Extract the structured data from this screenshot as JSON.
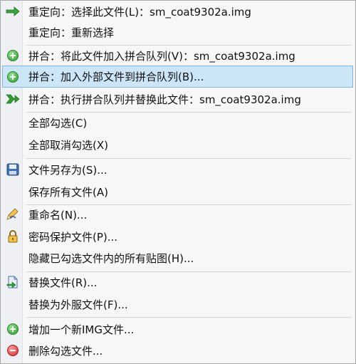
{
  "menu": {
    "items": [
      {
        "name": "redirect-select-this-file",
        "label": "重定向：选择此文件(L)：sm_coat9302a.img",
        "icon": "green-arrow-right-icon"
      },
      {
        "name": "redirect-reselect",
        "label": "重定向：重新选择",
        "icon": ""
      },
      {
        "name": "merge-add-this-file",
        "label": "拼合：将此文件加入拼合队列(V)：sm_coat9302a.img",
        "icon": "green-plus-circle-icon"
      },
      {
        "name": "merge-add-external-files",
        "label": "拼合：加入外部文件到拼合队列(B)...",
        "icon": "green-plus-circle-icon"
      },
      {
        "name": "merge-execute-replace",
        "label": "拼合：执行拼合队列并替换此文件：sm_coat9302a.img",
        "icon": "green-merge-arrow-icon"
      },
      {
        "name": "select-all",
        "label": "全部勾选(C)",
        "icon": ""
      },
      {
        "name": "deselect-all",
        "label": "全部取消勾选(X)",
        "icon": ""
      },
      {
        "name": "save-file-as",
        "label": "文件另存为(S)...",
        "icon": "floppy-disk-icon"
      },
      {
        "name": "save-all-files",
        "label": "保存所有文件(A)",
        "icon": ""
      },
      {
        "name": "rename",
        "label": "重命名(N)...",
        "icon": "rename-pencil-icon"
      },
      {
        "name": "password-protect",
        "label": "密码保护文件(P)...",
        "icon": "padlock-icon"
      },
      {
        "name": "hide-textures",
        "label": "隐藏已勾选文件内的所有贴图(H)...",
        "icon": ""
      },
      {
        "name": "replace-file",
        "label": "替换文件(R)...",
        "icon": "replace-file-icon"
      },
      {
        "name": "replace-with-costume",
        "label": "替换为外服文件(F)...",
        "icon": ""
      },
      {
        "name": "add-new-img",
        "label": "增加一个新IMG文件...",
        "icon": "green-plus-circle-icon"
      },
      {
        "name": "delete-selected",
        "label": "删除勾选文件...",
        "icon": "red-minus-circle-icon"
      }
    ]
  },
  "colors": {
    "highlight_bg": "#cde6f7",
    "highlight_border": "#7fb6e6",
    "menu_bg": "#f7f7f7",
    "gutter_bg": "#eef0f3"
  }
}
